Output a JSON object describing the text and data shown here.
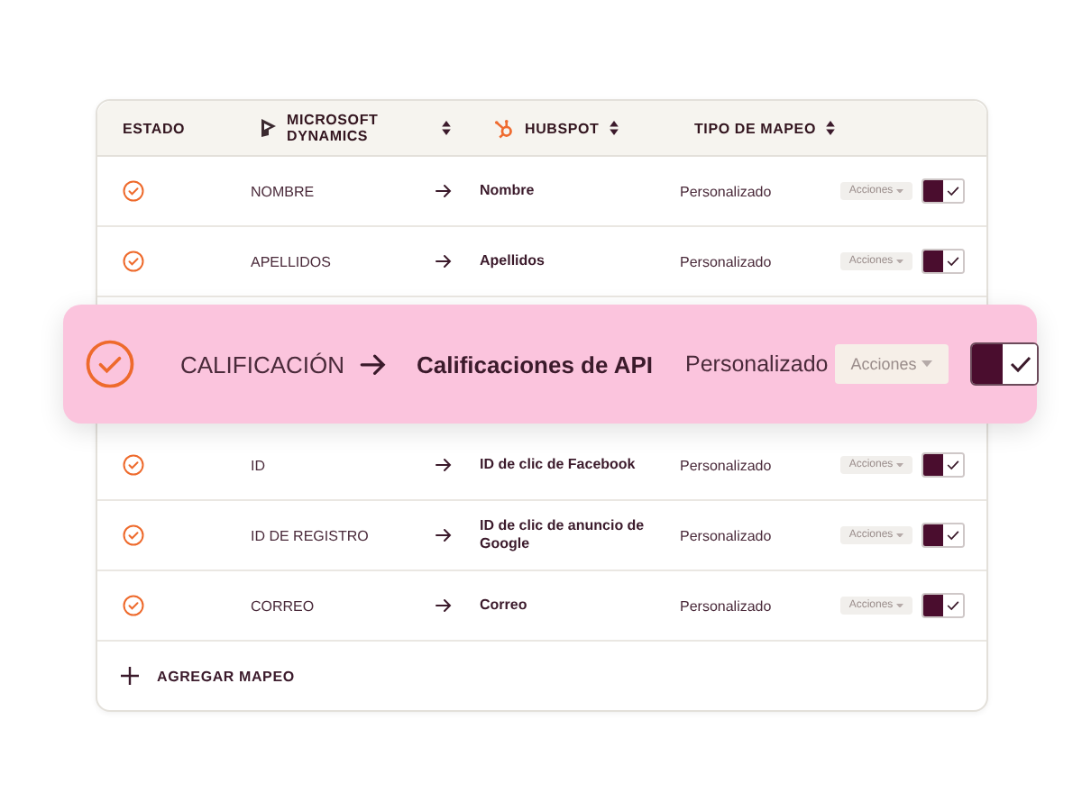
{
  "table": {
    "columns": [
      {
        "label": "ESTADO",
        "kind": "plain",
        "sortable": false
      },
      {
        "label": "MICROSOFT DYNAMICS",
        "kind": "dynamics",
        "sortable": true
      },
      {
        "label": "HUBSPOT",
        "kind": "hubspot",
        "sortable": true
      },
      {
        "label": "TIPO DE MAPEO",
        "kind": "plain",
        "sortable": true
      }
    ],
    "rows": [
      {
        "kind": "row",
        "source": "NOMBRE",
        "target": "Nombre",
        "mapping_type": "Personalizado",
        "action": "Acciones",
        "action_disabled": true,
        "enabled": true
      },
      {
        "kind": "row",
        "source": "APELLIDOS",
        "target": "Apellidos",
        "mapping_type": "Personalizado",
        "action": "Acciones",
        "action_disabled": true,
        "enabled": true
      },
      {
        "kind": "highlight",
        "source": "CALIFICACIÓN",
        "target": "Calificaciones de API",
        "mapping_type": "Personalizado",
        "action": "Acciones",
        "action_disabled": true,
        "enabled": true
      },
      {
        "kind": "row",
        "source": "ID",
        "target": "ID de clic de Facebook",
        "mapping_type": "Personalizado",
        "action": "Acciones",
        "action_disabled": true,
        "enabled": true
      },
      {
        "kind": "row",
        "source": "ID DE REGISTRO",
        "target": "ID de clic de anuncio de Google",
        "mapping_type": "Personalizado",
        "action": "Acciones",
        "action_disabled": true,
        "enabled": true
      },
      {
        "kind": "row",
        "source": "CORREO",
        "target": "Correo",
        "mapping_type": "Personalizado",
        "action": "Acciones",
        "action_disabled": true,
        "enabled": true
      }
    ],
    "add_button": "AGREGAR MAPEO"
  }
}
